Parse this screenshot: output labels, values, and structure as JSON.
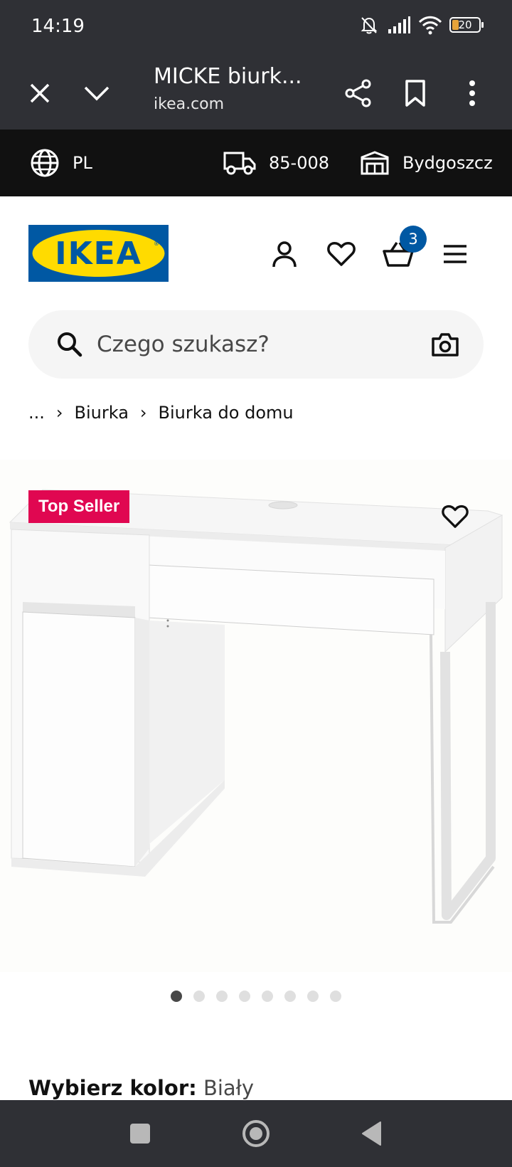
{
  "status_bar": {
    "time": "14:19",
    "battery_level": "20",
    "icons": [
      "bell-mute-icon",
      "signal-icon",
      "wifi-icon",
      "battery-icon"
    ]
  },
  "browser_tab": {
    "title": "MICKE biurk...",
    "url": "ikea.com",
    "icons": [
      "close-icon",
      "chevron-down-icon",
      "share-icon",
      "bookmark-icon",
      "more-vertical-icon"
    ]
  },
  "location_bar": {
    "country": "PL",
    "postcode": "85-008",
    "store": "Bydgoszcz"
  },
  "header": {
    "logo_text": "IKEA",
    "cart_count": "3",
    "colors": {
      "brand_blue": "#0058a3",
      "brand_yellow": "#ffdb00"
    }
  },
  "search": {
    "placeholder": "Czego szukasz?"
  },
  "breadcrumb": {
    "ellipsis": "...",
    "items": [
      "Biurka",
      "Biurka do domu"
    ]
  },
  "product": {
    "badge": "Top Seller",
    "badge_color": "#e00751",
    "image_count": 8,
    "active_image_index": 0
  },
  "color_select": {
    "label": "Wybierz kolor:",
    "value": "Biały"
  }
}
